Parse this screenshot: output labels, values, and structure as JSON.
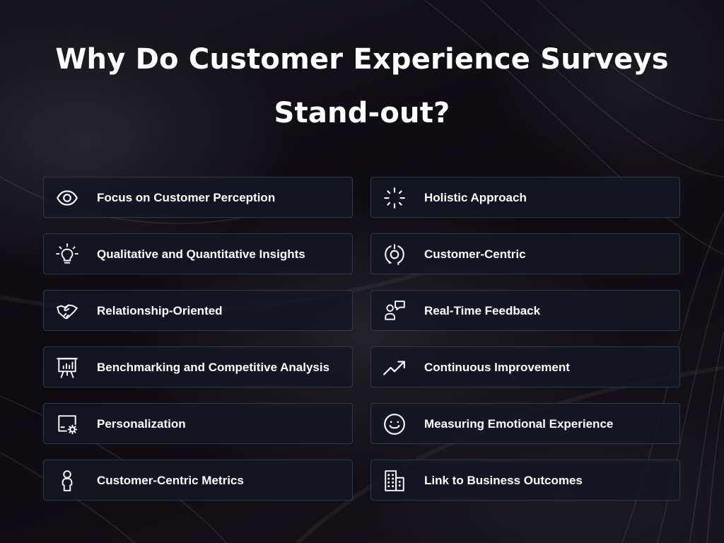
{
  "title": "Why Do Customer Experience Surveys Stand-out?",
  "accent_colors": {
    "background": "#0f0d13",
    "card": "#14162a",
    "text": "#ffffff"
  },
  "cards": {
    "left": [
      {
        "label": "Focus on Customer Perception",
        "icon": "eye-icon"
      },
      {
        "label": "Qualitative and Quantitative Insights",
        "icon": "lightbulb-icon"
      },
      {
        "label": "Relationship-Oriented",
        "icon": "handshake-icon"
      },
      {
        "label": "Benchmarking and Competitive Analysis",
        "icon": "presentation-chart-icon"
      },
      {
        "label": "Personalization",
        "icon": "screen-gear-icon"
      },
      {
        "label": "Customer-Centric Metrics",
        "icon": "person-icon"
      }
    ],
    "right": [
      {
        "label": "Holistic Approach",
        "icon": "loader-rays-icon"
      },
      {
        "label": "Customer-Centric",
        "icon": "power-cycle-icon"
      },
      {
        "label": "Real-Time Feedback",
        "icon": "user-chat-icon"
      },
      {
        "label": "Continuous Improvement",
        "icon": "trending-up-icon"
      },
      {
        "label": "Measuring Emotional Experience",
        "icon": "smiley-icon"
      },
      {
        "label": "Link to Business Outcomes",
        "icon": "building-icon"
      }
    ]
  }
}
